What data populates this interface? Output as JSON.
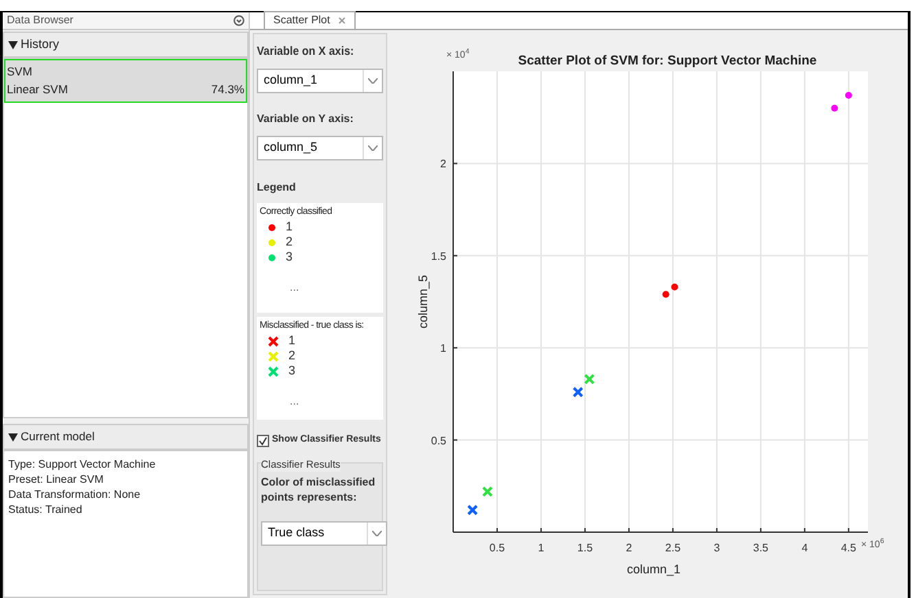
{
  "data_browser": {
    "title": "Data Browser"
  },
  "history": {
    "title": "History",
    "expanded": true,
    "items": [
      {
        "name": "SVM",
        "preset": "Linear SVM",
        "accuracy": "74.3%",
        "selected": true
      }
    ]
  },
  "current_model": {
    "title": "Current model",
    "expanded": true,
    "lines": [
      "Type: Support Vector Machine",
      "Preset: Linear SVM",
      "Data Transformation: None",
      "Status: Trained"
    ]
  },
  "tabs": [
    {
      "label": "Scatter Plot",
      "selected": true
    }
  ],
  "controls": {
    "x_label": "Variable on X axis:",
    "x_value": "column_1",
    "y_label": "Variable on Y axis:",
    "y_value": "column_5",
    "legend_title": "Legend",
    "correct": {
      "title": "Correctly classified",
      "items": [
        {
          "label": "1",
          "color": "#ff0000"
        },
        {
          "label": "2",
          "color": "#e6f000"
        },
        {
          "label": "3",
          "color": "#00e070"
        }
      ],
      "more": "..."
    },
    "misclassified": {
      "title": "Misclassified - true class is:",
      "items": [
        {
          "label": "1",
          "color": "#ff0000"
        },
        {
          "label": "2",
          "color": "#e6f000"
        },
        {
          "label": "3",
          "color": "#00e070"
        }
      ],
      "more": "..."
    },
    "show_results": {
      "label": "Show Classifier Results",
      "checked": true
    },
    "group_title": "Classifier Results",
    "color_label": "Color of misclassified points represents:",
    "color_value": "True class"
  },
  "plot": {
    "series_markers": [
      {
        "kind": "dot"
      },
      {
        "kind": "dot"
      },
      {
        "kind": "cross"
      },
      {
        "kind": "cross"
      }
    ],
    "y_multiplier": "× 10$^{4}$",
    "x_multiplier": "× 10$^{6}$",
    "chart_data": {
      "type": "scatter",
      "title": "Scatter Plot of SVM for: Support Vector Machine",
      "xlabel": "column_1",
      "ylabel": "column_5",
      "xlim": [
        0,
        4.72
      ],
      "ylim": [
        0,
        2.5
      ],
      "grid": true,
      "xticks": [
        {
          "value": 0.5,
          "label": "0.5"
        },
        {
          "value": 1,
          "label": "1"
        },
        {
          "value": 1.5,
          "label": "1.5"
        },
        {
          "value": 2,
          "label": "2"
        },
        {
          "value": 2.5,
          "label": "2.5"
        },
        {
          "value": 3,
          "label": "3"
        },
        {
          "value": 3.5,
          "label": "3.5"
        },
        {
          "value": 4,
          "label": "4"
        },
        {
          "value": 4.5,
          "label": "4.5"
        }
      ],
      "yticks": [
        {
          "value": 0.5,
          "label": "0.5"
        },
        {
          "value": 1,
          "label": "1"
        },
        {
          "value": 1.5,
          "label": "1.5"
        },
        {
          "value": 2,
          "label": "2"
        }
      ],
      "series": [
        {
          "color": "#ff00ff",
          "x": [
            4.34,
            4.5
          ],
          "values": [
            2.3,
            2.37
          ]
        },
        {
          "color": "#ff0000",
          "x": [
            2.42,
            2.52
          ],
          "values": [
            1.29,
            1.33
          ]
        },
        {
          "color": "#1060ff",
          "x": [
            1.42,
            0.22
          ],
          "values": [
            0.76,
            0.12
          ]
        },
        {
          "color": "#30e040",
          "x": [
            1.55,
            0.39
          ],
          "values": [
            0.83,
            0.22
          ]
        }
      ]
    }
  }
}
